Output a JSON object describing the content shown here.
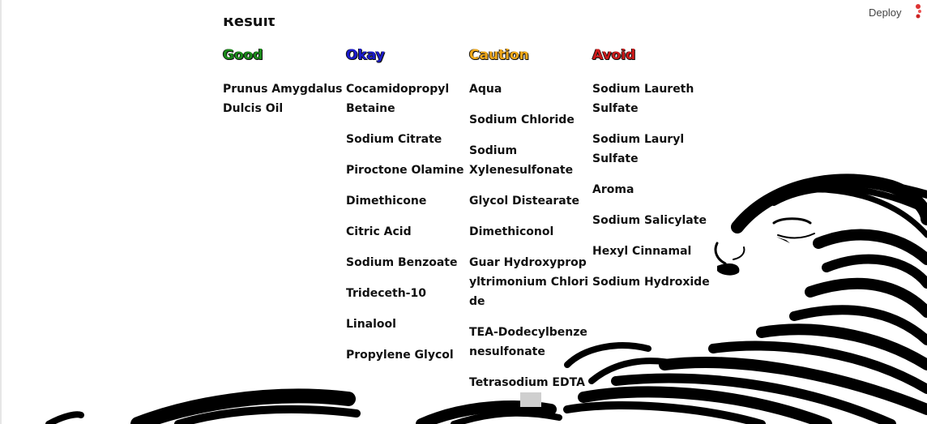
{
  "header": {
    "deploy_label": "Deploy",
    "menu_icon": "ellipsis-vertical-icon"
  },
  "result": {
    "title": "Result"
  },
  "columns": [
    {
      "label": "Good",
      "color": "#1a8a1a",
      "items": [
        "Prunus Amygdalus Dulcis Oil"
      ]
    },
    {
      "label": "Okay",
      "color": "#1a1acc",
      "items": [
        "Cocamidopropyl Betaine",
        "Sodium Citrate",
        "Piroctone Olamine",
        "Dimethicone",
        "Citric Acid",
        "Sodium Benzoate",
        "Trideceth-10",
        "Linalool",
        "Propylene Glycol"
      ]
    },
    {
      "label": "Caution",
      "color": "#f0a81a",
      "items": [
        "Aqua",
        "Sodium Chloride",
        "Sodium Xylenesulfonate",
        "Glycol Distearate",
        "Dimethiconol",
        "Guar Hydroxypropyltrimonium Chloride",
        "TEA-Dodecylbenzenesulfonate",
        "Tetrasodium EDTA"
      ]
    },
    {
      "label": "Avoid",
      "color": "#cc1a1a",
      "items": [
        "Sodium Laureth Sulfate",
        "Sodium Lauryl Sulfate",
        "Aroma",
        "Sodium Salicylate",
        "Hexyl Cinnamal",
        "Sodium Hydroxide"
      ]
    }
  ]
}
